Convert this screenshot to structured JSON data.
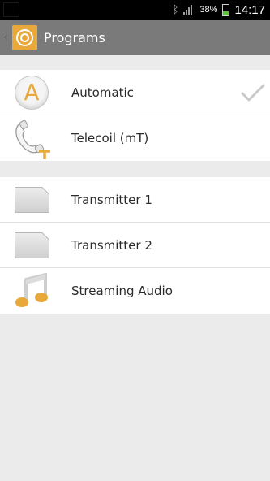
{
  "status_bar": {
    "battery_percent": "38%",
    "battery_level": 0.38,
    "time": "14:17",
    "icons": [
      "bluetooth-icon",
      "signal-icon",
      "battery-icon"
    ]
  },
  "action_bar": {
    "title": "Programs",
    "icons": [
      "back-chevron-icon",
      "app-icon"
    ]
  },
  "colors": {
    "accent": "#e8a93a",
    "action_bar": "#7a7a7a",
    "background": "#ebebeb",
    "status_bar": "#000000"
  },
  "programs": {
    "group1": [
      {
        "label": "Automatic",
        "icon": "automatic-icon",
        "icon_letter": "A",
        "selected": true
      },
      {
        "label": "Telecoil (mT)",
        "icon": "telecoil-icon",
        "selected": false
      }
    ],
    "group2": [
      {
        "label": "Transmitter 1",
        "icon": "transmitter-icon",
        "selected": false
      },
      {
        "label": "Transmitter 2",
        "icon": "transmitter-icon",
        "selected": false
      },
      {
        "label": "Streaming Audio",
        "icon": "music-note-icon",
        "selected": false
      }
    ]
  }
}
